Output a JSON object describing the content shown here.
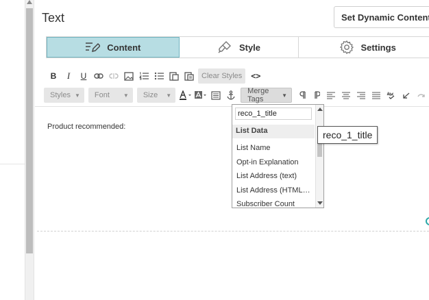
{
  "panel": {
    "title": "Text",
    "dynamic_button_label": "Set Dynamic Content"
  },
  "tabs": [
    {
      "label": "Content",
      "icon": "pencil-lines-icon",
      "active": true
    },
    {
      "label": "Style",
      "icon": "brush-icon",
      "active": false
    },
    {
      "label": "Settings",
      "icon": "gear-icon",
      "active": false
    }
  ],
  "toolbar_row1": {
    "bold": "B",
    "italic": "I",
    "underline": "U",
    "clear_styles": "Clear Styles",
    "source": "<>"
  },
  "toolbar_row2": {
    "styles": "Styles",
    "font": "Font",
    "size": "Size",
    "merge_tags": "Merge Tags"
  },
  "editor": {
    "text": "Product recommended:"
  },
  "merge_dropdown": {
    "search_value": "reco_1_title",
    "section_header": "List Data",
    "items": [
      "List Name",
      "Opt-in Explanation",
      "List Address (text)",
      "List Address (HTML…",
      "Subscriber Count"
    ]
  },
  "tooltip": {
    "text": "reco_1_title"
  },
  "colors": {
    "active_tab": "#b7dde3",
    "active_tab_border": "#6fb3bf",
    "accent": "#2aa7a7"
  }
}
